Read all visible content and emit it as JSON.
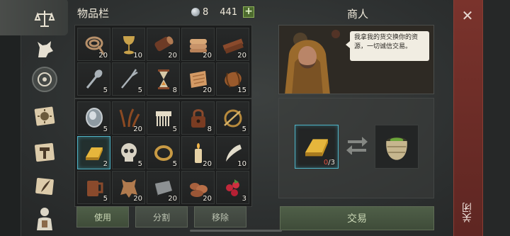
{
  "inventory": {
    "title": "物品栏",
    "silver": "8",
    "gold": "441",
    "plus_label": "+",
    "top_slots": [
      {
        "icon": "rope-icon",
        "qty": "20"
      },
      {
        "icon": "goblet-icon",
        "qty": "10"
      },
      {
        "icon": "log-icon",
        "qty": "20"
      },
      {
        "icon": "leather-roll-icon",
        "qty": "20"
      },
      {
        "icon": "plank-icon",
        "qty": "20"
      },
      {
        "icon": "spoon-icon",
        "qty": "5"
      },
      {
        "icon": "fork-icon",
        "qty": "5"
      },
      {
        "icon": "hourglass-icon",
        "qty": "8"
      },
      {
        "icon": "scroll-pelt-icon",
        "qty": "20"
      },
      {
        "icon": "barrel-icon",
        "qty": "15"
      }
    ],
    "bottom_slots": [
      {
        "icon": "mirror-icon",
        "qty": "5"
      },
      {
        "icon": "herb-icon",
        "qty": "20"
      },
      {
        "icon": "comb-icon",
        "qty": "5"
      },
      {
        "icon": "padlock-icon",
        "qty": "8"
      },
      {
        "icon": "brooch-icon",
        "qty": "5"
      },
      {
        "icon": "gold-bar-icon",
        "qty": "2"
      },
      {
        "icon": "skull-icon",
        "qty": "5"
      },
      {
        "icon": "ring-icon",
        "qty": "5"
      },
      {
        "icon": "candle-icon",
        "qty": "20"
      },
      {
        "icon": "tooth-icon",
        "qty": "10"
      },
      {
        "icon": "mug-icon",
        "qty": "5"
      },
      {
        "icon": "hide-icon",
        "qty": "20"
      },
      {
        "icon": "stone-icon",
        "qty": "20"
      },
      {
        "icon": "mushroom-icon",
        "qty": "20"
      },
      {
        "icon": "berries-icon",
        "qty": "3"
      }
    ],
    "buttons": {
      "use": "使用",
      "split": "分割",
      "remove": "移除"
    }
  },
  "merchant": {
    "title": "商人",
    "speech": "我拿我的货交换你的资源，一切诚信交易。",
    "offer_count": "0",
    "offer_need": "/3",
    "trade_button": "交易"
  },
  "close": {
    "label": "关闭"
  },
  "colors": {
    "accent": "#4fb3c6",
    "close_red": "#7a332c",
    "confirm_green": "#4f5f48"
  }
}
